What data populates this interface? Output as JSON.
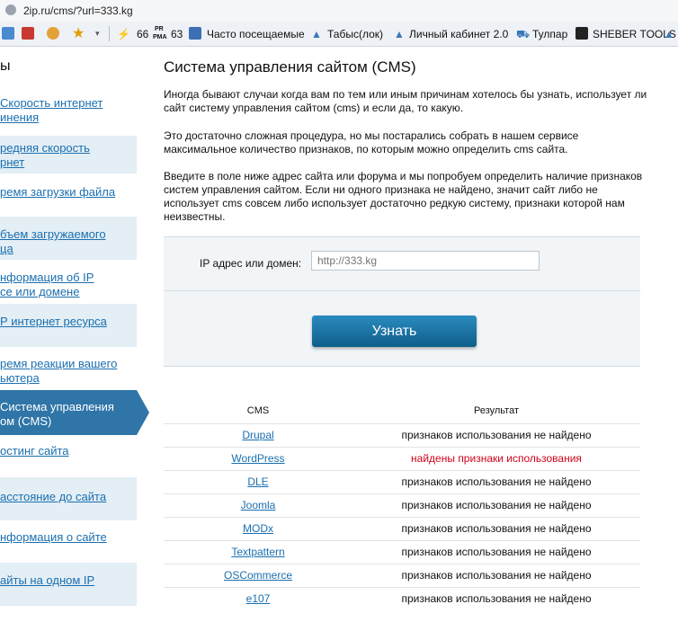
{
  "address_bar": {
    "url": "2ip.ru/cms/?url=333.kg"
  },
  "bookmarks": {
    "count_66": "66",
    "pr_label": "PR",
    "pma_label": "PMA",
    "count_63": "63",
    "items": [
      "Часто посещаемые",
      "Табыс(лок)",
      "Личный кабинет 2.0",
      "Тулпар",
      "SHEBER TOOLS"
    ]
  },
  "sidebar": {
    "heading": "ы",
    "items": [
      {
        "line1": "Скорость интернет",
        "line2": "инения"
      },
      {
        "line1": "редняя скорость",
        "line2": "рнет"
      },
      {
        "line1": "ремя загрузки файла",
        "line2": ""
      },
      {
        "line1": "бъем загружаемого",
        "line2": "ца"
      },
      {
        "line1": "нформация об IP",
        "line2": "се или домене"
      },
      {
        "line1": "Р интернет ресурса",
        "line2": ""
      },
      {
        "line1": "ремя реакции вашего",
        "line2": "ьютера"
      },
      {
        "line1": "Система управления",
        "line2": "ом (CMS)"
      },
      {
        "line1": "остинг сайта",
        "line2": ""
      },
      {
        "line1": "асстояние до сайта",
        "line2": ""
      },
      {
        "line1": "нформация о сайте",
        "line2": ""
      },
      {
        "line1": "айты на одном IP",
        "line2": ""
      }
    ]
  },
  "main": {
    "title": "Система управления сайтом (CMS)",
    "para1": "Иногда бывают случаи когда вам по тем или иным причинам хотелось бы узнать, использует ли сайт систему управления сайтом (cms) и если да, то какую.",
    "para2": "Это достаточно сложная процедура, но мы постарались собрать в нашем сервисе максимальное количество признаков, по которым можно определить cms сайта.",
    "para3": "Введите в поле ниже адрес сайта или форума и мы попробуем определить наличие признаков систем управления сайтом. Если ни одного признака не найдено, значит сайт либо не использует cms совсем либо использует достаточно редкую систему, признаки которой нам неизвестны.",
    "form": {
      "label": "IP адрес или домен:",
      "placeholder": "http://333.kg",
      "button": "Узнать"
    },
    "table": {
      "col_cms": "CMS",
      "col_result": "Результат",
      "rows": [
        {
          "cms": "Drupal",
          "result": "признаков использования не найдено"
        },
        {
          "cms": "WordPress",
          "result": "найдены признаки использования"
        },
        {
          "cms": "DLE",
          "result": "признаков использования не найдено"
        },
        {
          "cms": "Joomla",
          "result": "признаков использования не найдено"
        },
        {
          "cms": "MODx",
          "result": "признаков использования не найдено"
        },
        {
          "cms": "Textpattern",
          "result": "признаков использования не найдено"
        },
        {
          "cms": "OSCommerce",
          "result": "признаков использования не найдено"
        },
        {
          "cms": "e107",
          "result": "признаков использования не найдено"
        }
      ]
    }
  },
  "colors": {
    "link": "#1a6fb0",
    "active_sidebar": "#2f75a8",
    "found_red": "#d0021b",
    "button": "#1b74a6"
  }
}
